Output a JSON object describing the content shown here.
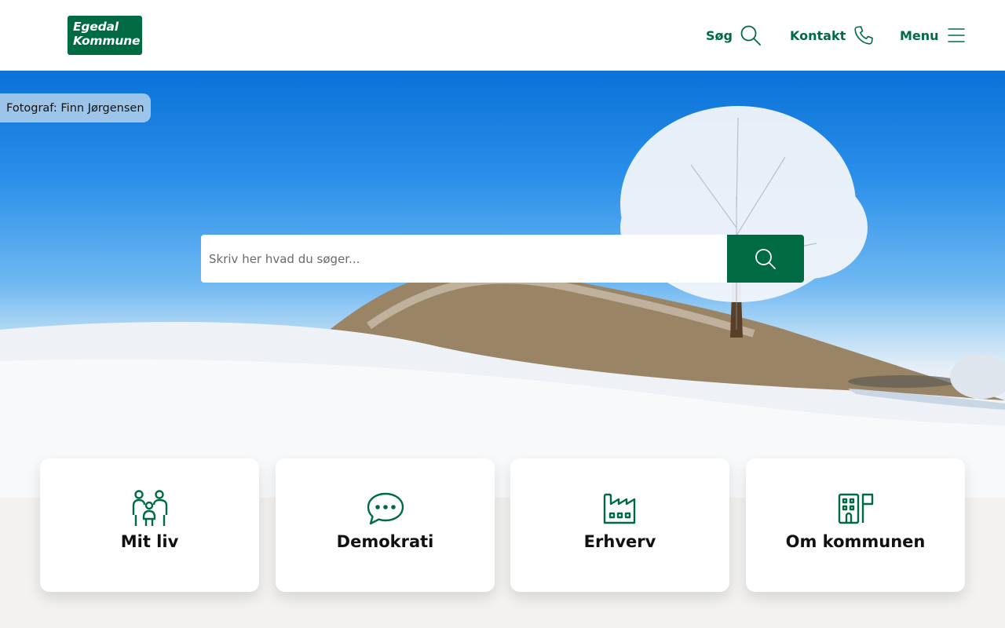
{
  "header": {
    "logo_line1": "Egedal",
    "logo_line2": "Kommune",
    "nav": {
      "search_label": "Søg",
      "search_icon": "search-icon",
      "contact_label": "Kontakt",
      "contact_icon": "phone-icon",
      "menu_label": "Menu",
      "menu_icon": "hamburger-icon"
    }
  },
  "hero": {
    "photo_credit": "Fotograf: Finn Jørgensen",
    "search_placeholder": "Skriv her hvad du søger...",
    "search_button_icon": "search-icon"
  },
  "cards": [
    {
      "title": "Mit liv",
      "icon": "family-icon"
    },
    {
      "title": "Demokrati",
      "icon": "speech-bubble-icon"
    },
    {
      "title": "Erhverv",
      "icon": "factory-icon"
    },
    {
      "title": "Om kommunen",
      "icon": "building-flag-icon"
    }
  ],
  "colors": {
    "brand_green": "#006b43",
    "background": "#f3f2f0"
  }
}
